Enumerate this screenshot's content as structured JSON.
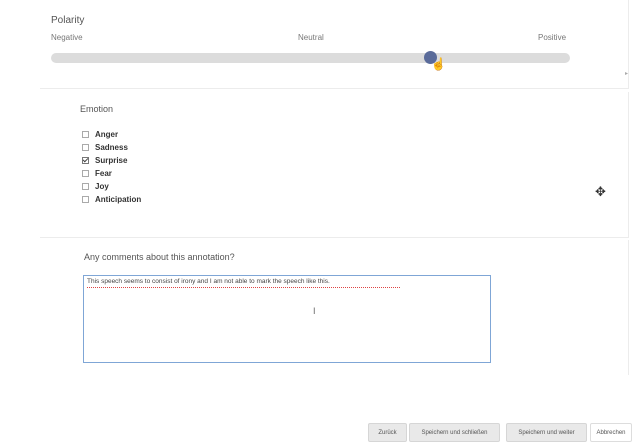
{
  "polarity": {
    "title": "Polarity",
    "scale_labels": {
      "negative": "Negative",
      "neutral": "Neutral",
      "positive": "Positive"
    },
    "value_fraction": 0.73
  },
  "emotion": {
    "title": "Emotion",
    "options": [
      {
        "label": "Anger",
        "checked": false
      },
      {
        "label": "Sadness",
        "checked": false
      },
      {
        "label": "Surprise",
        "checked": true
      },
      {
        "label": "Fear",
        "checked": false
      },
      {
        "label": "Joy",
        "checked": false
      },
      {
        "label": "Anticipation",
        "checked": false
      }
    ]
  },
  "comments": {
    "label": "Any comments about this annotation?",
    "value": "This speech seems to consist of irony and I am not able to mark the speech like this."
  },
  "footer": {
    "back_label": "Zurück",
    "save_close_label": "Speichern und schließen",
    "save_next_label": "Speichern und weiter",
    "cancel_label": "Abbrechen"
  },
  "colors": {
    "slider_thumb": "#5a6b9a",
    "slider_track": "#dcdcdc",
    "input_border": "#7fa6d6"
  }
}
